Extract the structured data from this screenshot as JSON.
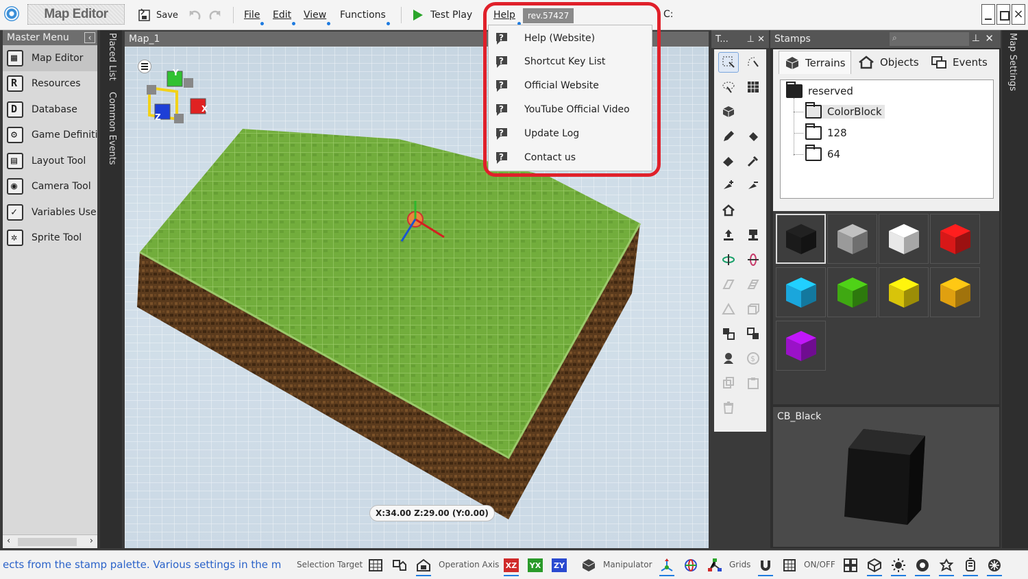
{
  "app": {
    "title": "Map Editor"
  },
  "toolbar": {
    "save_label": "Save",
    "menus": [
      "File",
      "Edit",
      "View",
      "Functions"
    ],
    "test_play_label": "Test Play",
    "help_label": "Help",
    "revision": "rev.57427",
    "drive": "C:"
  },
  "help_menu": {
    "items": [
      "Help (Website)",
      "Shortcut Key List",
      "Official Website",
      "YouTube Official Video",
      "Update Log",
      "Contact us"
    ]
  },
  "master_menu": {
    "title": "Master Menu",
    "items": [
      "Map Editor",
      "Resources",
      "Database",
      "Game Definiti",
      "Layout Tool",
      "Camera Tool",
      "Variables Use",
      "Sprite Tool"
    ]
  },
  "side_tabs": [
    "Placed List",
    "Common Events"
  ],
  "map": {
    "tab_title": "Map_1",
    "coordinates": "X:34.00 Z:29.00 (Y:0.00)",
    "gizmo_axes": [
      "Y",
      "X",
      "Z"
    ]
  },
  "tools_panel": {
    "title": "T..."
  },
  "stamps": {
    "title": "Stamps",
    "tabs": [
      "Terrains",
      "Objects",
      "Events"
    ],
    "tree": [
      "reserved",
      "ColorBlock",
      "128",
      "64"
    ],
    "palette_colors": [
      "#1a1a1a",
      "#9a9a9a",
      "#e8e8e8",
      "#d81818",
      "#1aa6dc",
      "#3fa812",
      "#d8c40a",
      "#e0a010",
      "#9a12c8"
    ],
    "preview_label": "CB_Black"
  },
  "map_settings_label": "Map Settings",
  "status": {
    "message": "ects from the stamp palette.  Various settings in the m",
    "selection_target": "Selection Target",
    "operation_axis": "Operation Axis",
    "axes": [
      "XZ",
      "YX",
      "ZY"
    ],
    "manipulator": "Manipulator",
    "grids": "Grids",
    "onoff": "ON/OFF"
  },
  "colors": {
    "accent": "#1e7be0",
    "highlight": "#e0202a",
    "grass": "#6ea83a",
    "dirt": "#5a3a1c"
  }
}
